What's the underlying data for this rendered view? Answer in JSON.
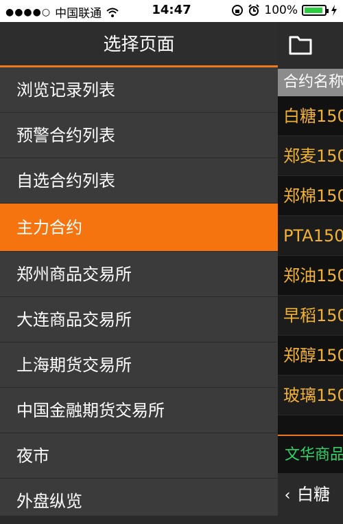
{
  "status_bar": {
    "signal_dots": "●●●●○",
    "carrier": "中国联通",
    "time": "14:47",
    "battery_percent": "100%"
  },
  "drawer": {
    "title": "选择页面",
    "items": [
      {
        "label": "浏览记录列表",
        "active": false
      },
      {
        "label": "预警合约列表",
        "active": false
      },
      {
        "label": "自选合约列表",
        "active": false
      },
      {
        "label": "主力合约",
        "active": true
      },
      {
        "label": "郑州商品交易所",
        "active": false
      },
      {
        "label": "大连商品交易所",
        "active": false
      },
      {
        "label": "上海期货交易所",
        "active": false
      },
      {
        "label": "中国金融期货交易所",
        "active": false
      },
      {
        "label": "夜市",
        "active": false
      },
      {
        "label": "外盘纵览",
        "active": false
      }
    ]
  },
  "panel": {
    "column_header": "合约名称",
    "rows": [
      "白糖150",
      "郑麦150",
      "郑棉150",
      "PTA150",
      "郑油150",
      "早稻150",
      "郑醇150",
      "玻璃150"
    ],
    "green_label": "文华商品",
    "bottom_label": "白糖"
  },
  "colors": {
    "accent": "#f5740f",
    "contract_text": "#f2b233",
    "green_text": "#2fd36a"
  }
}
